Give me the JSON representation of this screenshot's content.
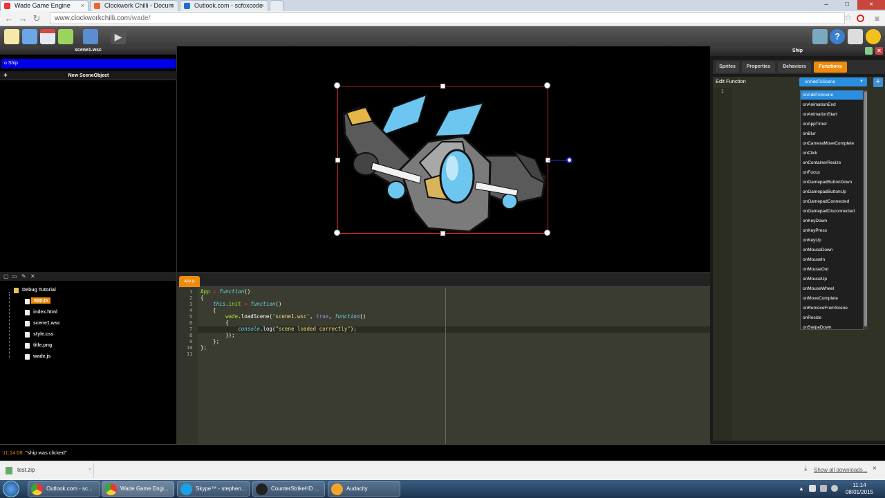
{
  "browser": {
    "tabs": [
      {
        "title": "Wade Game Engine",
        "active": true
      },
      {
        "title": "Clockwork Chilli - Docum",
        "active": false
      },
      {
        "title": "Outlook.com - scfoxcode",
        "active": false
      }
    ],
    "url_host": "www.clockworkchilli.com",
    "url_path": "/wade/"
  },
  "left_panel": {
    "title": "scene1.wsc",
    "selected_object": "Ship",
    "new_object_label": "New SceneObject"
  },
  "file_tree": {
    "root": "Debug Tutorial",
    "files": [
      "app.js",
      "index.html",
      "scene1.wsc",
      "style.css",
      "title.png",
      "wade.js"
    ],
    "selected": "app.js"
  },
  "editor": {
    "tab": "app.js",
    "line_numbers": [
      "1",
      "2",
      "3",
      "4",
      "5",
      "6",
      "7",
      "8",
      "9",
      "10",
      "11"
    ]
  },
  "right_panel": {
    "title": "Ship",
    "tabs": [
      "Sprites",
      "Properties",
      "Behaviors",
      "Functions"
    ],
    "active_tab": "Functions",
    "edit_function_label": "Edit Function",
    "selected_function": "onAddToScene",
    "line_number": "1",
    "functions": [
      "onAddToScene",
      "onAnimationEnd",
      "onAnimationStart",
      "onAppTimer",
      "onBlur",
      "onCameraMoveComplete",
      "onClick",
      "onContainerResize",
      "onFocus",
      "onGamepadButtonDown",
      "onGamepadButtonUp",
      "onGamepadConnected",
      "onGamepadDisconnected",
      "onKeyDown",
      "onKeyPress",
      "onKeyUp",
      "onMouseDown",
      "onMouseIn",
      "onMouseOut",
      "onMouseUp",
      "onMouseWheel",
      "onMoveComplete",
      "onRemoveFromScene",
      "onResize",
      "onSwipeDown"
    ]
  },
  "console": {
    "time": "11:14:08",
    "message": "\"ship was clicked\""
  },
  "downloads": {
    "file": "test.zip",
    "show_all": "Show all downloads..."
  },
  "taskbar": {
    "items": [
      "Outlook.com - sc...",
      "Wade Game Engi...",
      "Skype™ - stephen...",
      "CounterStrikeHD ...",
      "Audacity"
    ],
    "time": "11:14",
    "date": "08/01/2015"
  },
  "colors": {
    "accent_orange": "#f08a0a",
    "selection_blue": "#0000e6",
    "dropdown_blue": "#2a8fe0"
  }
}
